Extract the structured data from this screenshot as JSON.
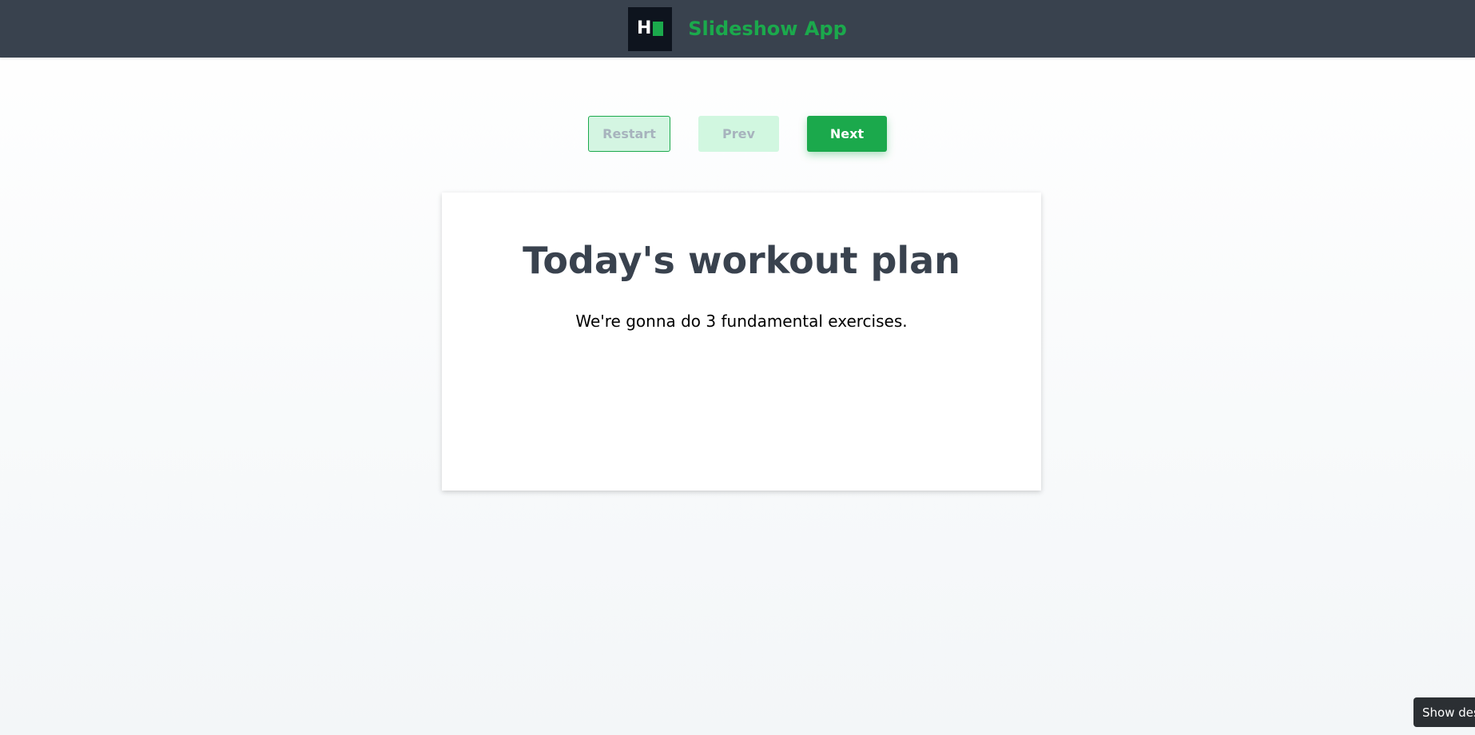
{
  "header": {
    "logo_letter": "H",
    "app_title": "Slideshow App",
    "brand_color": "#1ba94c",
    "background_color": "#39424e"
  },
  "controls": {
    "restart_label": "Restart",
    "prev_label": "Prev",
    "next_label": "Next"
  },
  "slide": {
    "title": "Today's workout plan",
    "text": "We're gonna do 3 fundamental exercises."
  },
  "toast": {
    "label": "Show desi"
  }
}
